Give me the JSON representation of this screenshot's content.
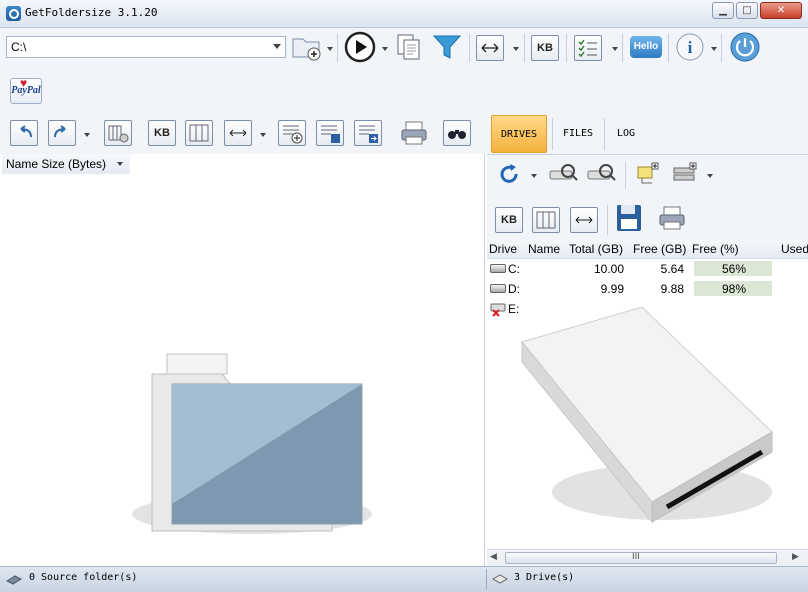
{
  "window": {
    "title": "GetFoldersize 3.1.20"
  },
  "address": {
    "path": "C:\\"
  },
  "toolbar": {
    "kb_label": "KB",
    "hello_label": "Hello"
  },
  "left_panel": {
    "column_header": "Name  Size (Bytes)",
    "kb_label": "KB"
  },
  "tabs": [
    {
      "label": "DRIVES",
      "active": true
    },
    {
      "label": "FILES",
      "active": false
    },
    {
      "label": "LOG",
      "active": false
    }
  ],
  "right_toolbar": {
    "kb_label": "KB"
  },
  "drives_table": {
    "headers": [
      "Drive",
      "Name",
      "Total (GB)",
      "Free (GB)",
      "Free (%)",
      "Used"
    ],
    "rows": [
      {
        "drive": "C:",
        "name": "",
        "total": "10.00",
        "free": "5.64",
        "free_pct": "56%",
        "free_fraction": 0.56
      },
      {
        "drive": "D:",
        "name": "",
        "total": "9.99",
        "free": "9.88",
        "free_pct": "98%",
        "free_fraction": 0.98
      },
      {
        "drive": "E:",
        "name": "",
        "total": "",
        "free": "",
        "free_pct": "",
        "free_fraction": 0
      }
    ]
  },
  "scrollbar": {
    "grip": "III"
  },
  "status": {
    "left": "0 Source folder(s)",
    "right": "3 Drive(s)"
  },
  "colors": {
    "accent": "#f5b23c",
    "free_bar": "#dbe7d4"
  }
}
